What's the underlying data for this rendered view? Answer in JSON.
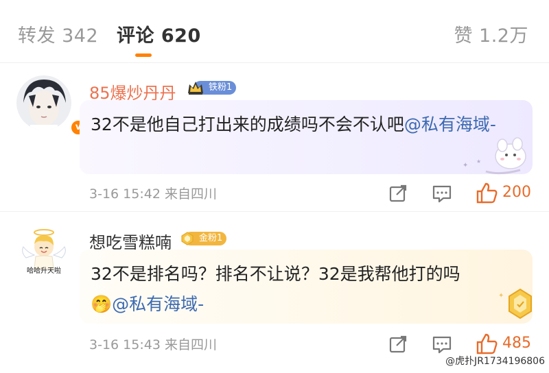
{
  "tabs": {
    "repost": "转发 342",
    "comment": "评论 620",
    "like": "赞 1.2万"
  },
  "comments": [
    {
      "username": "85爆炒丹丹",
      "fan_badge": "铁粉1",
      "text": "32不是他自己打出来的成绩吗不会不认吧",
      "mention": "@私有海域-",
      "meta": "3-16 15:42 来自四川",
      "likes": "200"
    },
    {
      "username": "想吃雪糕喃",
      "fan_badge": "金粉1",
      "avatar_text": "哈哈升天啦",
      "text": "32不是排名吗？排名不让说？32是我帮他打的吗",
      "emoji": "🤭",
      "mention": "@私有海域-",
      "meta": "3-16 15:43 来自四川",
      "likes": "485"
    }
  ],
  "watermark": "@虎扑JR1734196806",
  "icons": [
    "repost-icon",
    "comment-icon",
    "like-icon",
    "verified-icon",
    "crown-icon"
  ],
  "colors": {
    "accent": "#ff8200",
    "mention": "#3c6ab0",
    "username_highlight": "#eb7350"
  }
}
